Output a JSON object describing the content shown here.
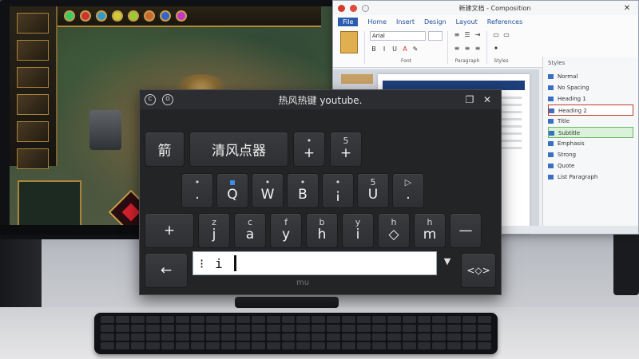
{
  "word": {
    "title": "新建文档 - Composition",
    "close": "✕",
    "menu": [
      "File",
      "Home",
      "Insert",
      "Design",
      "Layout",
      "References"
    ],
    "font_name": "Arial",
    "group_font": "Font",
    "group_paragraph": "Paragraph",
    "group_styles": "Styles",
    "pane_title": "Styles",
    "pane_items": [
      {
        "label": "Normal",
        "state": ""
      },
      {
        "label": "No Spacing",
        "state": ""
      },
      {
        "label": "Heading 1",
        "state": ""
      },
      {
        "label": "Heading 2",
        "state": "sel"
      },
      {
        "label": "Title",
        "state": ""
      },
      {
        "label": "Subtitle",
        "state": "ok"
      },
      {
        "label": "Emphasis",
        "state": ""
      },
      {
        "label": "Strong",
        "state": ""
      },
      {
        "label": "Quote",
        "state": ""
      },
      {
        "label": "List Paragraph",
        "state": ""
      }
    ]
  },
  "ime": {
    "title": "热风热键 youtube.",
    "ctrl_left": "C",
    "ctrl_right": "O",
    "restore": "❐",
    "close": "✕",
    "row1": [
      {
        "main": "箭",
        "top": "",
        "wide": true
      },
      {
        "main": "清风点器",
        "top": "",
        "wide": "xl"
      },
      {
        "main": "+",
        "top": "•",
        "wide": false
      },
      {
        "main": "+",
        "top": "5",
        "wide": false
      }
    ],
    "row2": [
      {
        "main": ".",
        "top": "•"
      },
      {
        "main": "Q",
        "top": "",
        "blue": true
      },
      {
        "main": "W",
        "top": "•"
      },
      {
        "main": "B",
        "top": "•"
      },
      {
        "main": "¡",
        "top": "•"
      },
      {
        "main": "U",
        "top": "5"
      },
      {
        "main": ".",
        "top": "▷"
      }
    ],
    "row3": [
      {
        "main": "+",
        "top": ""
      },
      {
        "main": "j",
        "top": "z"
      },
      {
        "main": "a",
        "top": "c"
      },
      {
        "main": "y",
        "top": "f"
      },
      {
        "main": "h",
        "top": "b"
      },
      {
        "main": "i",
        "top": "y"
      },
      {
        "main": "◇",
        "top": "h"
      },
      {
        "main": "m",
        "top": "h"
      },
      {
        "main": "—",
        "top": ""
      }
    ],
    "back_key": "←",
    "input_prefix": "⁝",
    "input_value": "i",
    "dropdown": "▼",
    "right_key": "<◇>",
    "tick": "mu"
  }
}
